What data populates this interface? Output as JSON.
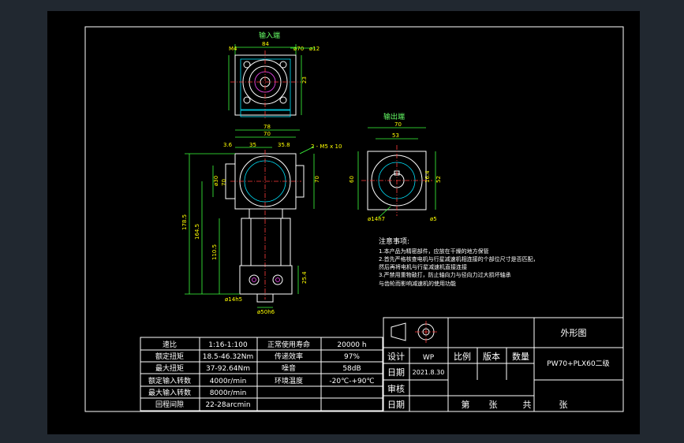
{
  "views": {
    "input_title": "输入端",
    "output_title": "输出端"
  },
  "dims": {
    "d84": "84",
    "d70a": "70",
    "d70b": "70",
    "dM6": "M6",
    "dM4": "M4",
    "dPCD": "ø70",
    "dShaft": "ø12",
    "d23": "23",
    "d78": "78",
    "d70c": "70",
    "d35": "35",
    "d3_6": "3.6",
    "d35_8": "35.8",
    "d70d": "70",
    "d70e": "70",
    "dHoles": "2 - M5 x 10",
    "d178_5": "178.5",
    "d164_5": "164.5",
    "d110_5": "110.5",
    "d25_4": "25.4",
    "dSide1": "ø30",
    "dSide2": "ø50h7",
    "dSide3": "ø14h7",
    "dBot1": "ø14h5",
    "dBot2": "ø50h6",
    "dO70": "70",
    "dO53": "53",
    "dO60": "60",
    "dO52": "52",
    "dO16": "16.4",
    "dO5": "5",
    "dOBot": "ø14h7",
    "dOBot2": "ø5"
  },
  "notes": {
    "title": "注意事项:",
    "lines": [
      "1.本产品为精密部件，应放在干燥的地方保管",
      "2.首先严格核查电机与行星减速机相连接的个部位尺寸是否匹配，",
      "  然后再将电机与行星减速机直接连接",
      "3.严禁用重物敲打，防止轴向力与径向力过大损坏轴承",
      "  与齿轮而影响减速机的使用功能"
    ]
  },
  "specs": [
    [
      "速比",
      "1:16-1:100",
      "正常使用寿命",
      "20000 h"
    ],
    [
      "额定扭矩",
      "18.5-46.32Nm",
      "传递效率",
      "97%"
    ],
    [
      "最大扭矩",
      "37-92.64Nm",
      "噪音",
      "58dB"
    ],
    [
      "额定输入转数",
      "4000r/min",
      "环境温度",
      "-20℃-+90℃"
    ],
    [
      "最大输入转数",
      "8000r/min",
      "",
      ""
    ],
    [
      "回程间隙",
      "22-28arcmin",
      "",
      ""
    ]
  ],
  "title_block": {
    "drawing_name": "外形图",
    "design_label": "设计",
    "designer": "WP",
    "scale_label": "比例",
    "version_label": "版本",
    "qty_label": "数量",
    "model": "PW70+PLX60二级",
    "date_label": "日期",
    "date": "2021.8.30",
    "review_label": "审核",
    "date_label2": "日期",
    "sheet_no": "第",
    "sheet_unit1": "张",
    "sheet_total": "共",
    "sheet_unit2": "张"
  }
}
